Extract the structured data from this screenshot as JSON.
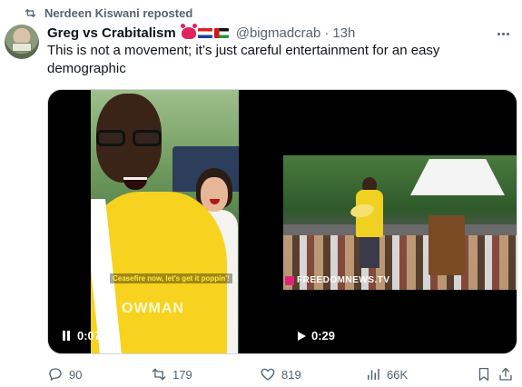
{
  "repost": {
    "icon": "retweet-icon",
    "text": "Nerdeen Kiswani reposted"
  },
  "tweet": {
    "author_name": "Greg vs Crabitalism",
    "name_emoji": [
      "crab-emoji",
      "croatia-flag-emoji",
      "palestine-flag-emoji"
    ],
    "handle": "@bigmadcrab",
    "separator": "·",
    "time": "13h",
    "text": "This is not a movement; it’s just careful entertainment for an easy demographic"
  },
  "media": {
    "left_video": {
      "caption": "Ceasefire now, let's get it poppin'!",
      "shirt_text": "OWMAN",
      "state_icon": "pause-icon",
      "time": "0:07"
    },
    "right_video": {
      "watermark": "FREEDOMNEWS.TV",
      "state_icon": "play-icon",
      "time": "0:29"
    }
  },
  "actions": {
    "replies": "90",
    "reposts": "179",
    "likes": "819",
    "views": "66K"
  },
  "colors": {
    "text_primary": "#0f1419",
    "text_secondary": "#536471",
    "border": "#cfd9de",
    "shirt_yellow": "#f7d21f",
    "watermark_pink": "#e0247a"
  }
}
